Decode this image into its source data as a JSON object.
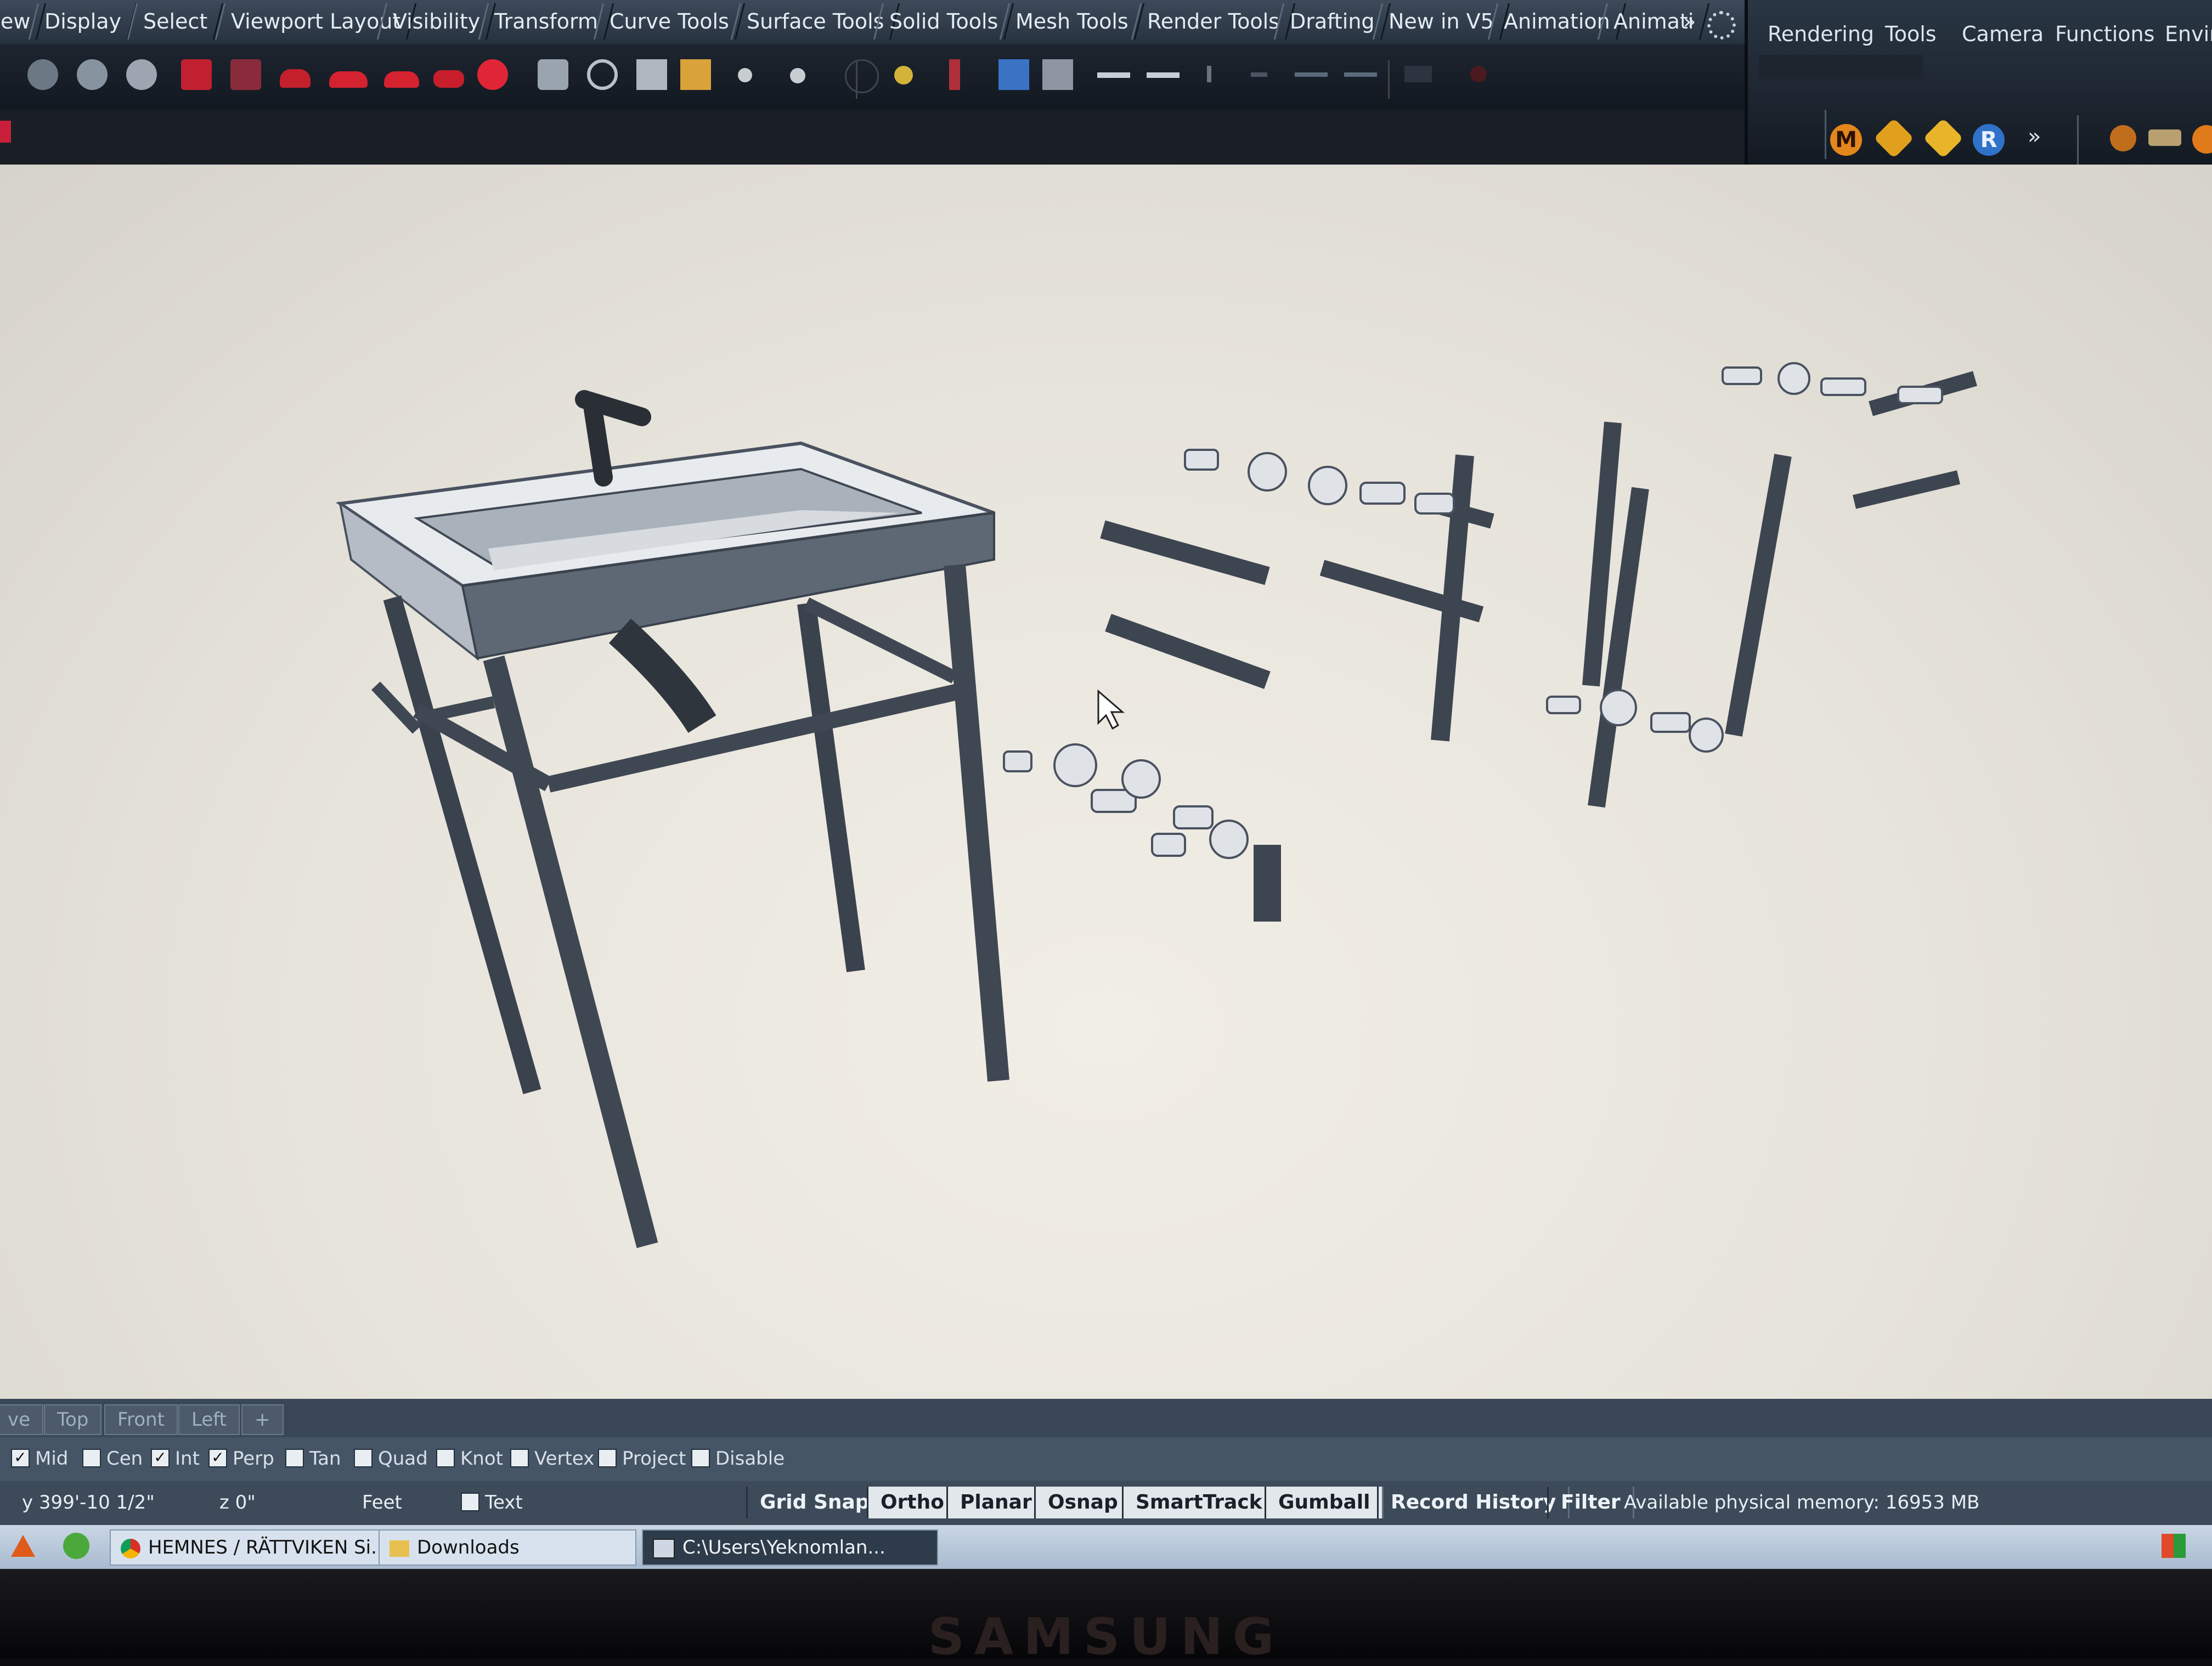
{
  "menu_tabs": [
    "ew",
    "Display",
    "Select",
    "Viewport Layout",
    "Visibility",
    "Transform",
    "Curve Tools",
    "Surface Tools",
    "Solid Tools",
    "Mesh Tools",
    "Render Tools",
    "Drafting",
    "New in V5",
    "Animation",
    "Animati",
    "»"
  ],
  "right_panel": {
    "tabs": [
      "Rendering",
      "Tools",
      "Camera",
      "Functions",
      "Envir"
    ],
    "more": "»"
  },
  "right_icons": [
    "M",
    "R"
  ],
  "viewport_tabs": [
    "ve",
    "Top",
    "Front",
    "Left",
    "+"
  ],
  "osnap": [
    {
      "label": "Mid",
      "checked": true
    },
    {
      "label": "Cen",
      "checked": false
    },
    {
      "label": "Int",
      "checked": true
    },
    {
      "label": "Perp",
      "checked": true
    },
    {
      "label": "Tan",
      "checked": false
    },
    {
      "label": "Quad",
      "checked": false
    },
    {
      "label": "Knot",
      "checked": false
    },
    {
      "label": "Vertex",
      "checked": false
    },
    {
      "label": "Project",
      "checked": false
    },
    {
      "label": "Disable",
      "checked": false
    }
  ],
  "status": {
    "y": "y 399'-10 1/2\"",
    "z": "z 0\"",
    "units": "Feet",
    "layer": "Text",
    "buttons": [
      "Grid Snap",
      "Ortho",
      "Planar",
      "Osnap",
      "SmartTrack",
      "Gumball",
      "Record History",
      "Filter"
    ],
    "memory": "Available physical memory: 16953 MB"
  },
  "taskbar": [
    "HEMNES / RÄTTVIKEN Si...",
    "Downloads",
    "C:\\Users\\Yeknomlan..."
  ],
  "brand": "SAMSUNG",
  "colors": {
    "viewport_bg": "#e8e5dd",
    "frame": "#3a4754",
    "metal": "#404a56"
  }
}
